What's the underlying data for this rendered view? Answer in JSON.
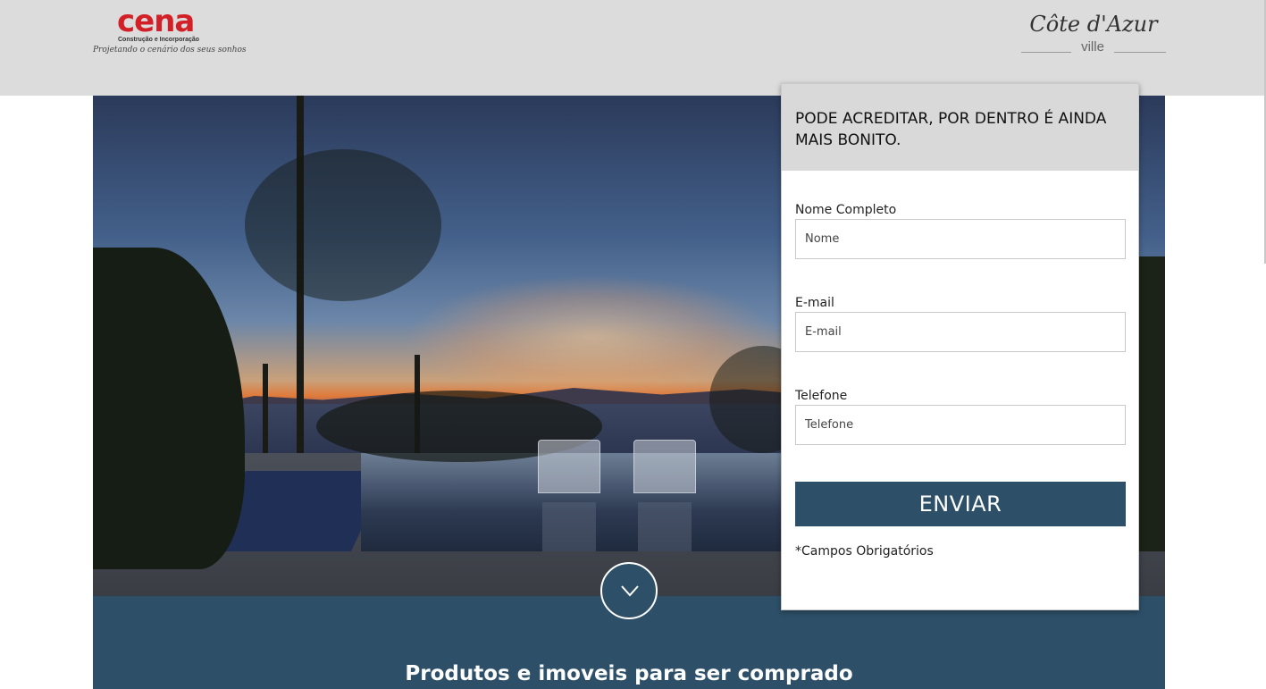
{
  "header": {
    "brand_left": {
      "name": "cena",
      "subtitle": "Construção e Incorporação",
      "tagline": "Projetando o cenário dos seus sonhos"
    },
    "brand_right": {
      "name": "Côte d'Azur",
      "sub": "ville"
    }
  },
  "form": {
    "title": "PODE ACREDITAR, POR DENTRO É AINDA MAIS BONITO.",
    "fields": [
      {
        "label": "Nome Completo",
        "placeholder": "Nome",
        "value": ""
      },
      {
        "label": "E-mail",
        "placeholder": "E-mail",
        "value": ""
      },
      {
        "label": "Telefone",
        "placeholder": "Telefone",
        "value": ""
      }
    ],
    "submit_label": "ENVIAR",
    "required_note": "*Campos Obrigatórios"
  },
  "scroll_button": {
    "icon": "chevron-down-icon"
  },
  "section": {
    "title": "Produtos e imoveis para ser comprado"
  },
  "colors": {
    "header_bg": "#dcdcdc",
    "accent": "#2d5068",
    "brand_red": "#d32027",
    "form_head_bg": "#d9d9d9"
  }
}
